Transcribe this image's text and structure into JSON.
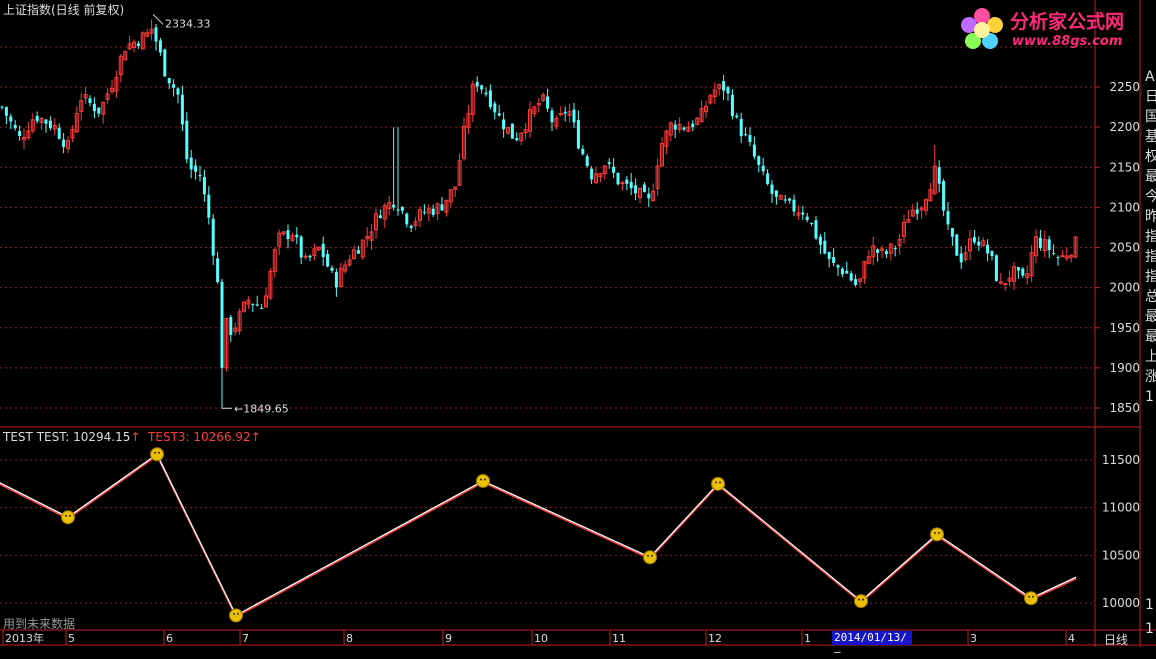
{
  "header": {
    "title": "上证指数(日线 前复权)",
    "high_label": "2334.33",
    "low_label": "1849.65"
  },
  "watermark": {
    "title": "分析家公式网",
    "url": "www.88gs.com"
  },
  "price_axis": {
    "ticks": [
      "2250",
      "2200",
      "2150",
      "2100",
      "2050",
      "2000",
      "1950",
      "1900",
      "1850"
    ]
  },
  "indicator": {
    "name_label": "TEST",
    "test_label": "TEST: 10294.15",
    "test3_label": "TEST3: 10266.92",
    "arrow": "↑",
    "ticks": [
      "11500",
      "11000",
      "10500",
      "10000"
    ],
    "future_note": "用到未来数据",
    "zigzag": [
      [
        0,
        11260
      ],
      [
        68,
        10900
      ],
      [
        157,
        11560
      ],
      [
        236,
        9870
      ],
      [
        483,
        11280
      ],
      [
        650,
        10480
      ],
      [
        718,
        11250
      ],
      [
        861,
        10020
      ],
      [
        937,
        10720
      ],
      [
        1031,
        10050
      ],
      [
        1076,
        10270
      ]
    ]
  },
  "date_axis": {
    "labels": [
      "2013年",
      "5",
      "6",
      "7",
      "8",
      "9",
      "10",
      "11",
      "12",
      "1",
      "3",
      "4"
    ],
    "cursor_date": "2014/01/13/—",
    "period": "日线"
  },
  "right_panel": {
    "chars": [
      "A",
      "日",
      "国",
      "基",
      "权",
      "最",
      "今",
      "昨",
      "指",
      "指",
      "指",
      "总",
      "最",
      "最",
      "上",
      "涨",
      "1"
    ],
    "indicator_tick": "1",
    "indicator_tick2": "1"
  },
  "colors": {
    "up": "#ff3b3b",
    "down": "#54ffff",
    "grid": "#8a1f1f",
    "axis": "#c02020"
  }
}
